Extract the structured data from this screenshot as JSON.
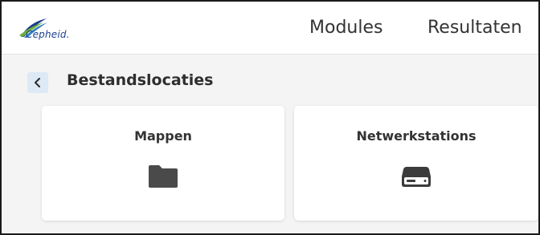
{
  "header": {
    "logo_text": "Cepheid.",
    "nav": {
      "modules": "Modules",
      "results": "Resultaten"
    }
  },
  "page": {
    "title": "Bestandslocaties",
    "back_icon": "chevron-left-icon"
  },
  "cards": [
    {
      "label": "Mappen",
      "icon": "folder-icon"
    },
    {
      "label": "Netwerkstations",
      "icon": "network-drive-icon"
    }
  ],
  "colors": {
    "brand": "#1b3f8f",
    "back_button_bg": "#dde9f5",
    "content_bg": "#f4f4f4",
    "icon": "#4a4a4a"
  }
}
